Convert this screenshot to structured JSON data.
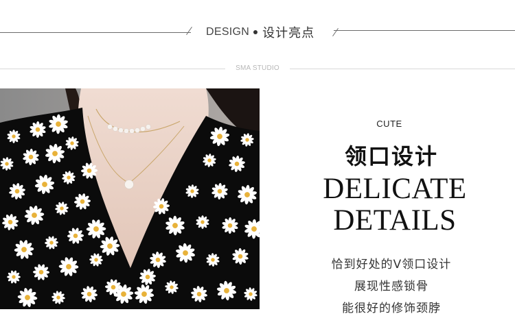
{
  "header": {
    "title_en": "DESIGN",
    "title_cn": "设计亮点",
    "studio": "SMA STUDIO"
  },
  "photo": {
    "alt_icon": "product-photo",
    "colors": {
      "fabric": "#0b0b0b",
      "petal": "#ffffff",
      "center": "#e8b23a",
      "skin": "#e9d3c7",
      "necklace": "#c9a66b"
    }
  },
  "feature": {
    "tag": "CUTE",
    "title_cn": "领口设计",
    "title_en_line1": "DELICATE",
    "title_en_line2": "DETAILS",
    "desc_lines": [
      "恰到好处的V领口设计",
      "展现性感锁骨",
      "能很好的修饰颈脖"
    ]
  }
}
